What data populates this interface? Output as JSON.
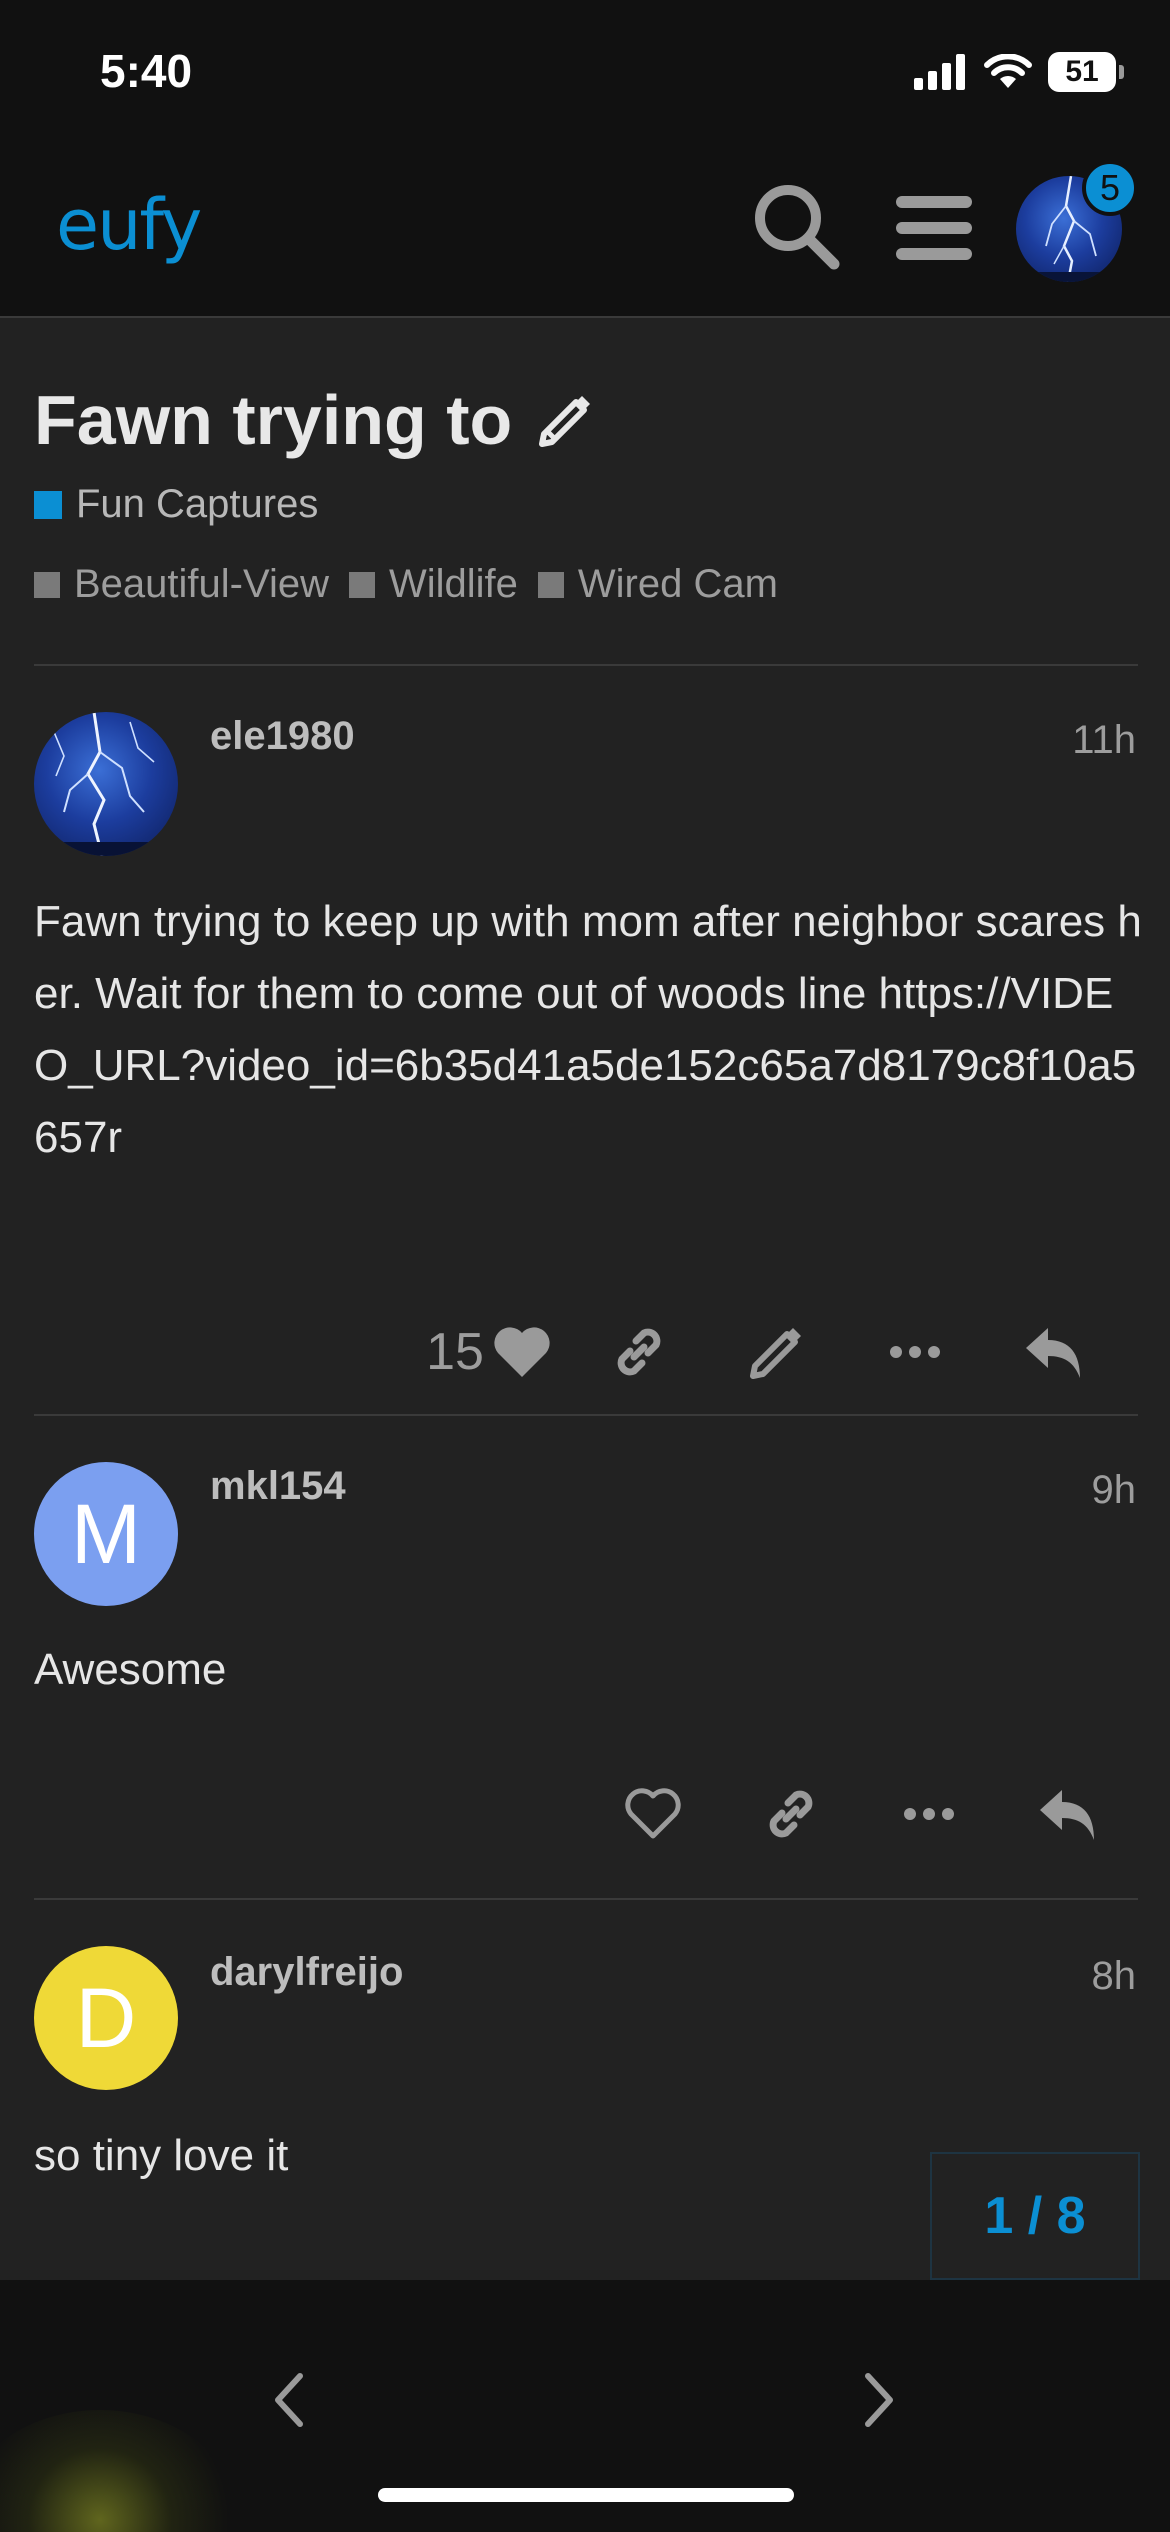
{
  "status_bar": {
    "time": "5:40",
    "battery": "51"
  },
  "header": {
    "logo": "eufy",
    "notification_count": "5"
  },
  "topic": {
    "title": "Fawn trying to",
    "category": "Fun Captures",
    "tags": [
      "Beautiful-View",
      "Wildlife",
      "Wired Cam"
    ]
  },
  "posts": [
    {
      "username": "ele1980",
      "time": "11h",
      "body": "Fawn trying to keep up with mom after neighbor scares her. Wait for them to come out of woods line https://VIDEO_URL?video_id=6b35d41a5de152c65a7d8179c8f10a5657r",
      "likes": "15"
    },
    {
      "username": "mkl154",
      "avatar_letter": "M",
      "avatar_color": "#7b9ff0",
      "time": "9h",
      "body": "Awesome"
    },
    {
      "username": "darylfreijo",
      "avatar_letter": "D",
      "avatar_color": "#efd937",
      "time": "8h",
      "body": "so tiny love it"
    }
  ],
  "progress": "1 / 8",
  "colors": {
    "accent": "#0b8fd3",
    "background": "#222222",
    "header": "#111111"
  }
}
